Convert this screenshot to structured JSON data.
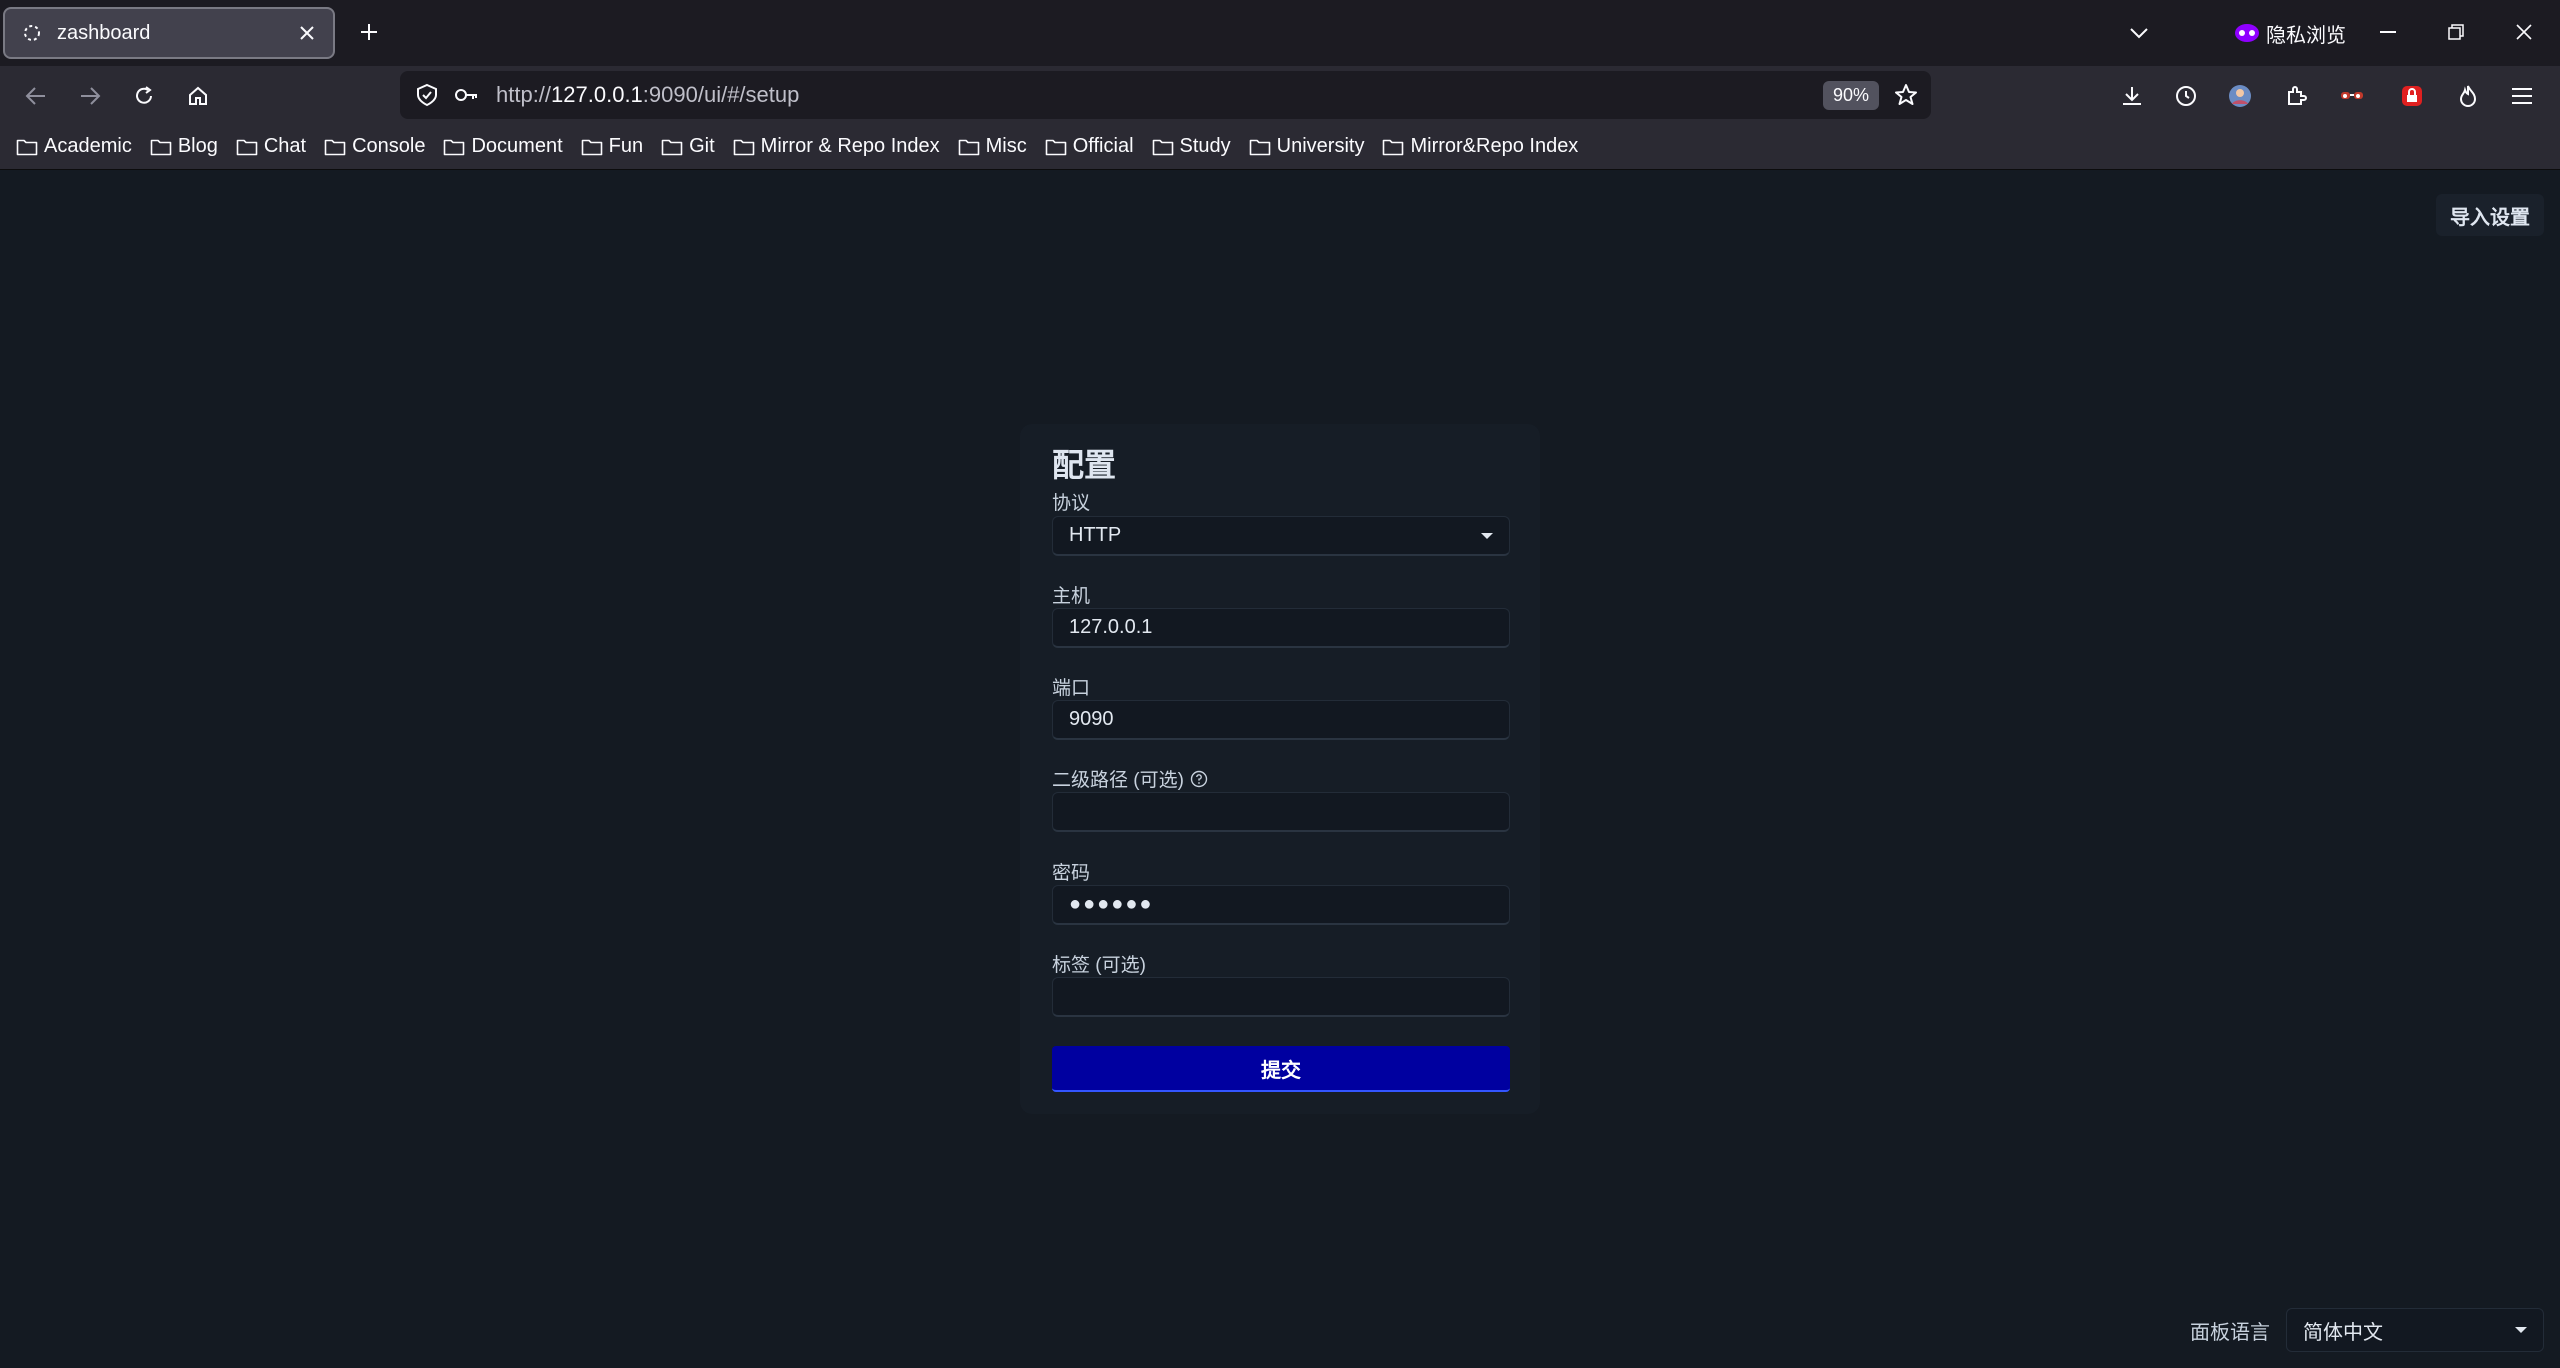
{
  "browser": {
    "tab": {
      "title": "zashboard"
    },
    "private_label": "隐私浏览",
    "url": {
      "prefix": "http://",
      "host": "127.0.0.1",
      "rest": ":9090/ui/#/setup"
    },
    "zoom": "90%",
    "bookmarks": [
      "Academic",
      "Blog",
      "Chat",
      "Console",
      "Document",
      "Fun",
      "Git",
      "Mirror & Repo Index",
      "Misc",
      "Official",
      "Study",
      "University",
      "Mirror&Repo Index"
    ]
  },
  "page": {
    "import_button": "导入设置",
    "form": {
      "title": "配置",
      "protocol": {
        "label": "协议",
        "value": "HTTP"
      },
      "host": {
        "label": "主机",
        "value": "127.0.0.1"
      },
      "port": {
        "label": "端口",
        "value": "9090"
      },
      "secondary_path": {
        "label": "二级路径 (可选)",
        "value": ""
      },
      "password": {
        "label": "密码",
        "value": "●●●●●●"
      },
      "tag": {
        "label": "标签 (可选)",
        "value": ""
      },
      "submit": "提交"
    },
    "language": {
      "label": "面板语言",
      "value": "简体中文"
    }
  },
  "colors": {
    "submit_bg": "#0000a0",
    "page_bg": "#141a22"
  }
}
